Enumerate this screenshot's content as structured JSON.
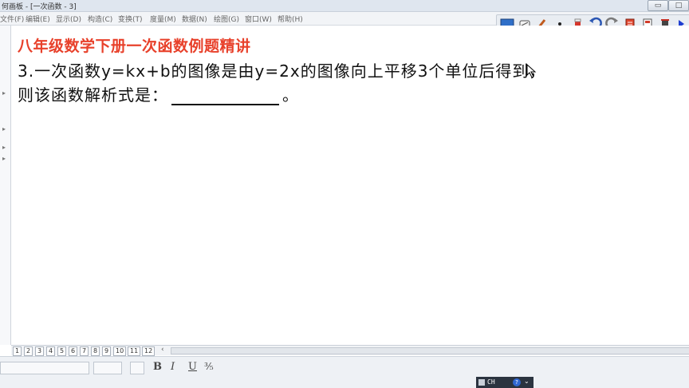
{
  "window": {
    "title": "何画板 - [一次函数 - 3]",
    "min_label": "▭",
    "close_label": "□"
  },
  "menu": {
    "items": [
      "文件(F)",
      "编辑(E)",
      "显示(D)",
      "构造(C)",
      "变换(T)",
      "度量(M)",
      "数据(N)",
      "绘图(G)",
      "窗口(W)",
      "帮助(H)"
    ]
  },
  "toolbar": {
    "icons": [
      "monitor-icon",
      "eraser-icon",
      "brush-icon",
      "dot-icon",
      "marker-icon",
      "undo-icon",
      "redo-icon",
      "page-icon",
      "trash-icon",
      "arrow-right-icon"
    ]
  },
  "content": {
    "heading": "八年级数学下册一次函数例题精讲",
    "line1": "3.一次函数y=kx+b的图像是由y=2x的图像向上平移3个单位后得到，",
    "line2_prefix": "则该函数解析式是：",
    "line2_suffix": "。"
  },
  "page_tabs": [
    "1",
    "2",
    "3",
    "4",
    "5",
    "6",
    "7",
    "8",
    "9",
    "10",
    "11",
    "12"
  ],
  "format": {
    "bold": "B",
    "italic": "I",
    "underline": "U",
    "special": "⅗"
  },
  "taskbar": {
    "lang": "CH"
  }
}
